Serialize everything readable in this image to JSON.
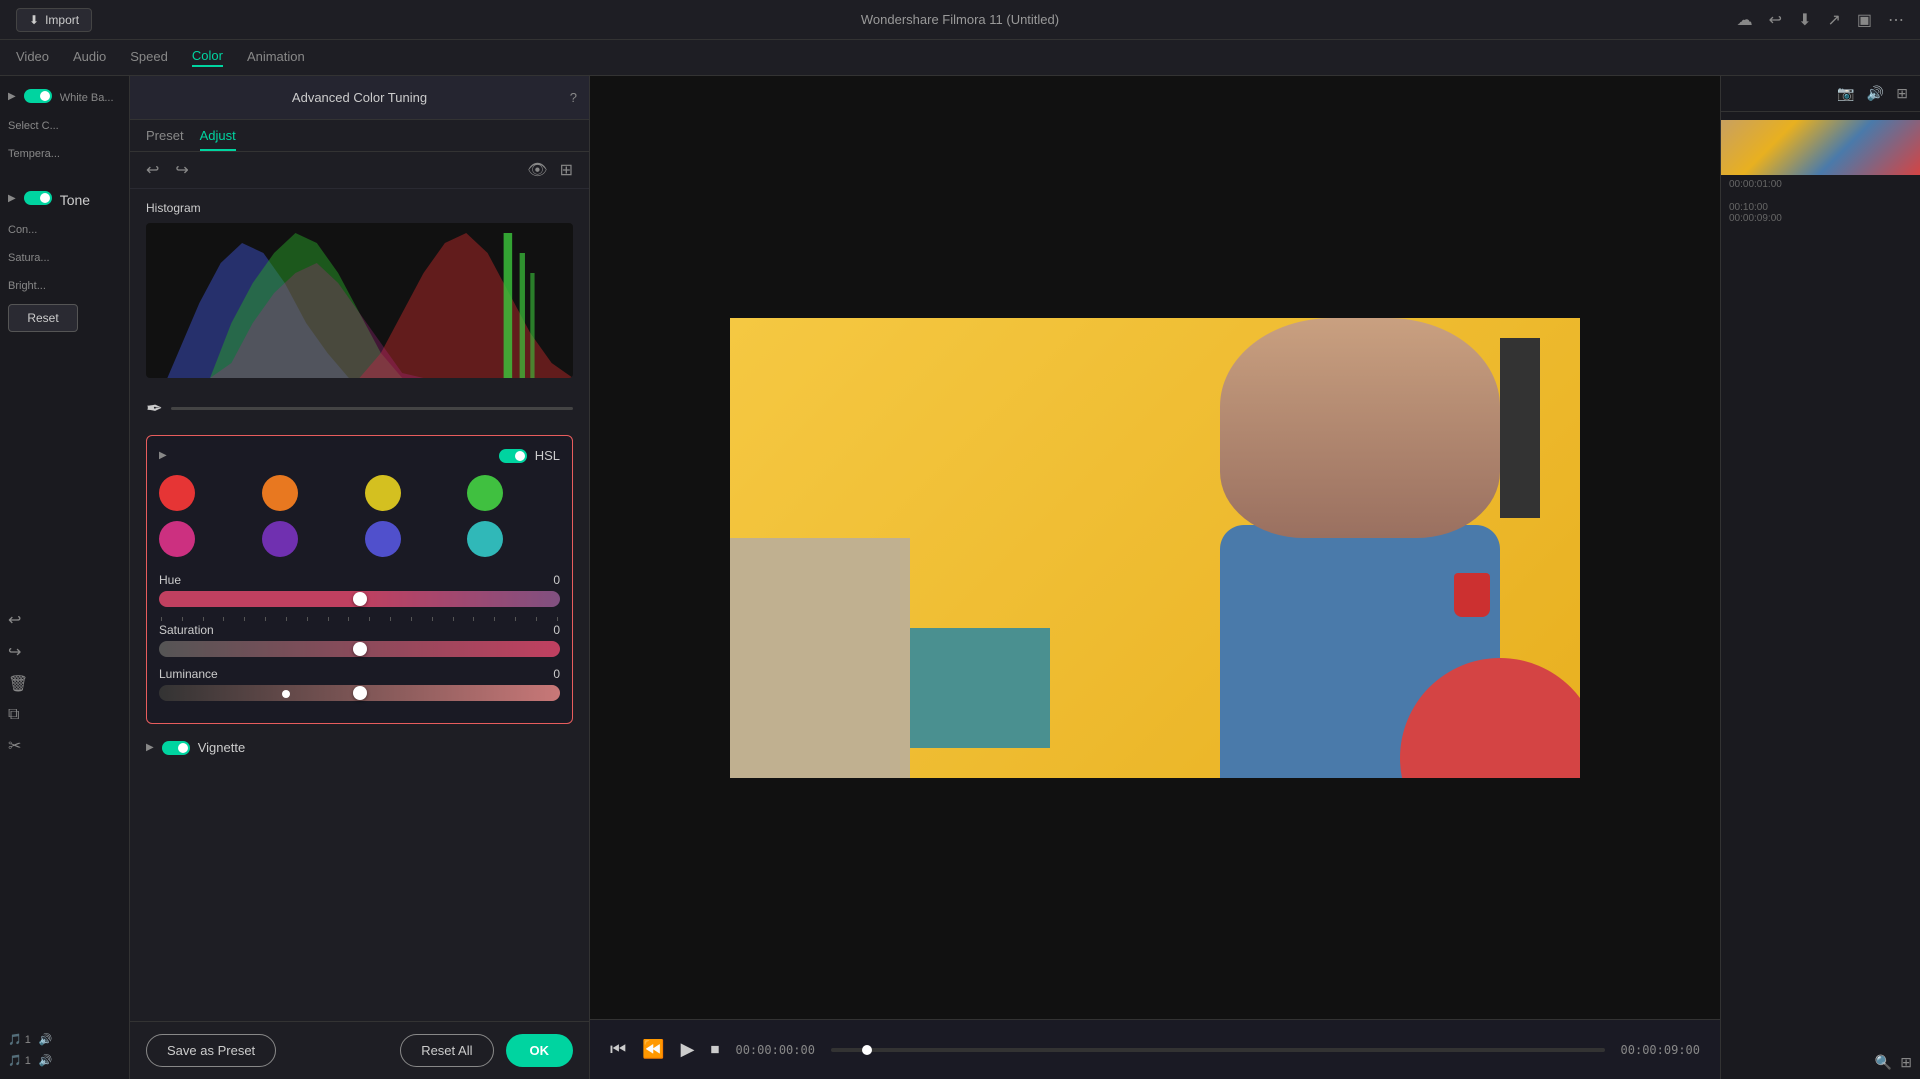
{
  "app": {
    "title": "Wondershare Filmora 11 (Untitled)",
    "window_controls": [
      "close",
      "minimize",
      "maximize"
    ]
  },
  "top_bar": {
    "import_label": "Import"
  },
  "tabs": {
    "items": [
      {
        "label": "Video",
        "active": false
      },
      {
        "label": "Audio",
        "active": false
      },
      {
        "label": "Speed",
        "active": false
      },
      {
        "label": "Color",
        "active": true
      },
      {
        "label": "Animation",
        "active": false
      }
    ]
  },
  "left_panel": {
    "white_balance_label": "White Ba...",
    "select_color_label": "Select C...",
    "temperature_label": "Tempera...",
    "tone_label": "Tone",
    "contrast_label": "Con...",
    "saturation_label": "Satura...",
    "brightness_label": "Bright...",
    "reset_label": "Reset"
  },
  "advanced_color_tuning": {
    "title": "Advanced Color Tuning",
    "tabs": [
      {
        "label": "Preset",
        "active": false
      },
      {
        "label": "Adjust",
        "active": true
      }
    ],
    "histogram_label": "Histogram",
    "hsl": {
      "label": "HSL",
      "enabled": true,
      "colors": [
        {
          "name": "red",
          "hex": "#e63535"
        },
        {
          "name": "orange",
          "hex": "#e87820"
        },
        {
          "name": "yellow",
          "hex": "#d4c020"
        },
        {
          "name": "green",
          "hex": "#40c040"
        },
        {
          "name": "magenta-pink",
          "hex": "#cc3080"
        },
        {
          "name": "purple",
          "hex": "#7030b0"
        },
        {
          "name": "blue-purple",
          "hex": "#5050cc"
        },
        {
          "name": "cyan",
          "hex": "#30b8b8"
        }
      ],
      "sliders": [
        {
          "label": "Hue",
          "value": 0
        },
        {
          "label": "Saturation",
          "value": 0
        },
        {
          "label": "Luminance",
          "value": 0
        }
      ]
    },
    "vignette_label": "Vignette",
    "vignette_enabled": true
  },
  "bottom_actions": {
    "save_preset_label": "Save as Preset",
    "reset_all_label": "Reset All",
    "ok_label": "OK"
  },
  "video_controls": {
    "time_start": "00:00:00:00",
    "time_end": "00:00:09:00"
  },
  "timeline": {
    "time_marker": "00:00:01:00",
    "zoom_times": [
      "00:10:00",
      "00:00:09:00"
    ]
  }
}
